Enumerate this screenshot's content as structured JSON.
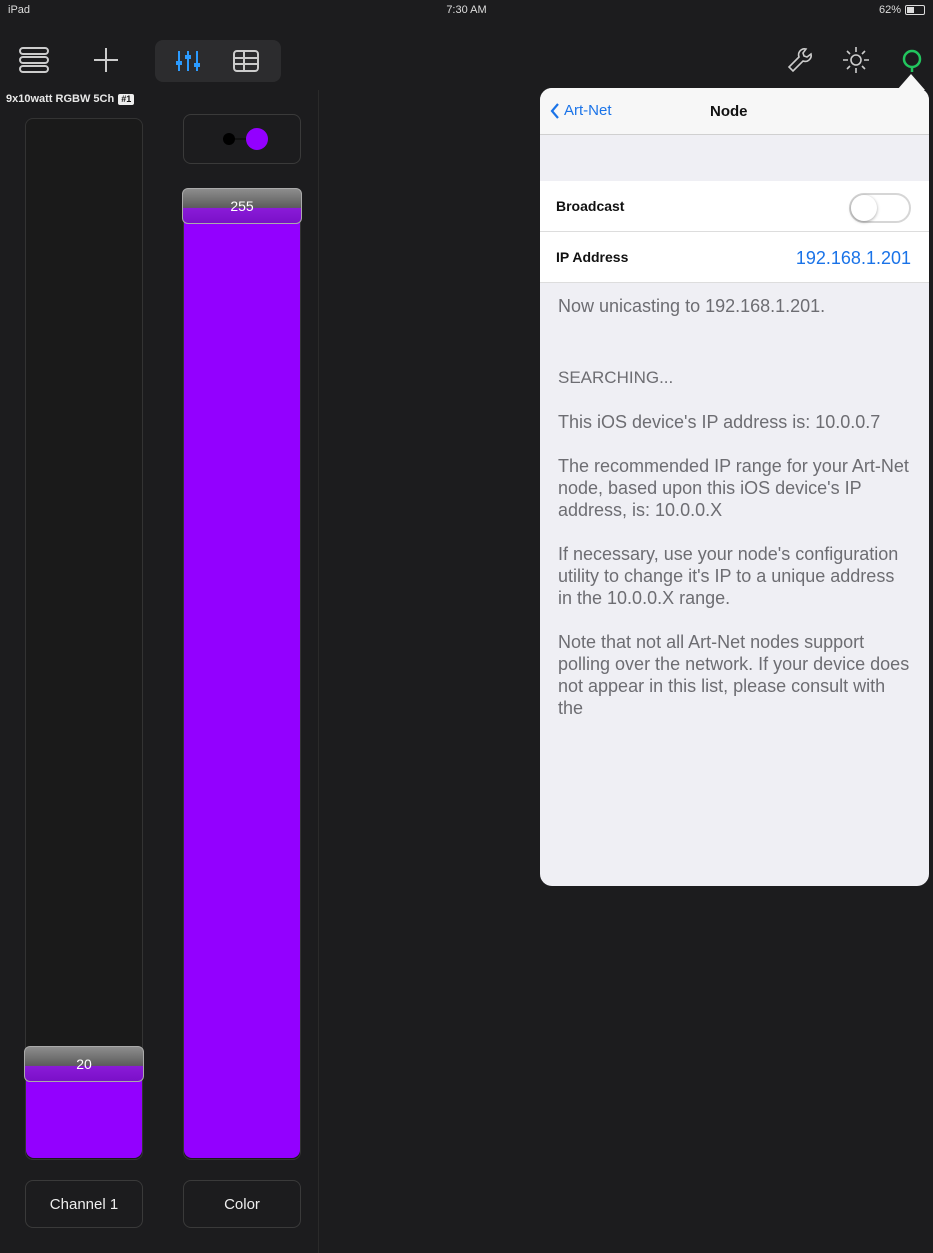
{
  "status": {
    "device": "iPad",
    "time": "7:30 AM",
    "battery": "62%"
  },
  "toolbar": {
    "menu_icon": "stack-icon",
    "add_icon": "plus-icon",
    "faders_icon": "sliders-icon",
    "table_icon": "grid-icon",
    "wrench_icon": "wrench-icon",
    "brightness_icon": "sun-icon",
    "network_icon": "ring-icon",
    "network_color": "#22c55e"
  },
  "fixture": {
    "name": "9x10watt RGBW 5Ch",
    "badge": "#1"
  },
  "faders": [
    {
      "label": "Channel 1",
      "value": "20",
      "level": 0.078
    },
    {
      "label": "Color",
      "value": "255",
      "level": 1.0
    }
  ],
  "accent": "#9300ff",
  "popover": {
    "back_label": "Art-Net",
    "title": "Node",
    "broadcast_label": "Broadcast",
    "broadcast_on": false,
    "ip_label": "IP Address",
    "ip_value": "192.168.1.201",
    "unicast_note": "Now unicasting to 192.168.1.201.",
    "searching": "SEARCHING...",
    "device_ip_note": "This iOS device's IP address is: 10.0.0.7",
    "range_note": "The recommended IP range for your Art-Net node, based upon this iOS device's IP address, is: 10.0.0.X",
    "config_note": "If necessary, use your node's configuration utility to change it's IP to a unique address in the 10.0.0.X range.",
    "polling_note": "Note that not all Art-Net nodes support polling over the network. If your device does not appear in this list, please consult with the"
  }
}
